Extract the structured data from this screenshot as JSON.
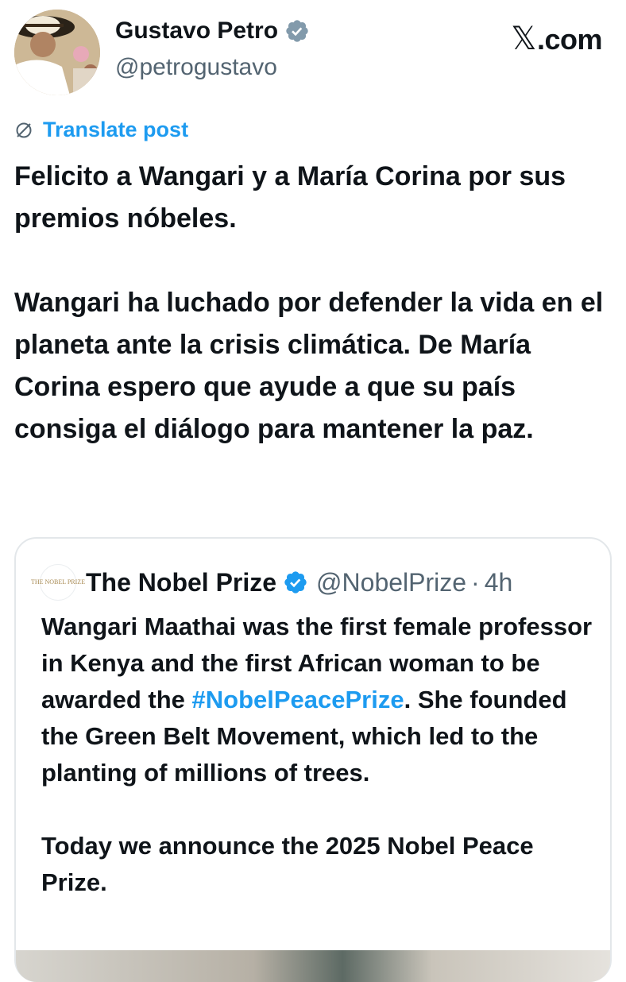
{
  "author": {
    "display_name": "Gustavo Petro",
    "handle": "@petrogustavo",
    "verified": true,
    "avatar_icon": "profile-photo"
  },
  "site": {
    "logo_x": "𝕏",
    "logo_domain": ".com"
  },
  "translate_label": "Translate post",
  "post_paragraphs": [
    "Felicito a Wangari y a María Corina por sus premios nóbeles.",
    "Wangari ha luchado por defender la vida en el planeta ante la crisis climática. De María Corina espero que ayude a que su país consiga el diálogo para mantener la paz."
  ],
  "quoted": {
    "logo_text": "THE NOBEL PRIZE",
    "display_name": "The Nobel Prize",
    "verified": true,
    "handle": "@NobelPrize",
    "separator": "·",
    "time": "4h",
    "text_part1": "Wangari Maathai was the first female professor in Kenya and the first African woman to be awarded the ",
    "hashtag": "#NobelPeacePrize",
    "text_part2": ". She founded the Green Belt Movement, which led to the planting of millions of trees.",
    "text_paragraph2": "Today we announce the 2025 Nobel Peace Prize."
  },
  "colors": {
    "link": "#1d9bf0",
    "secondary_text": "#536471",
    "primary_text": "#0f1419",
    "border": "#e3e7ea"
  }
}
